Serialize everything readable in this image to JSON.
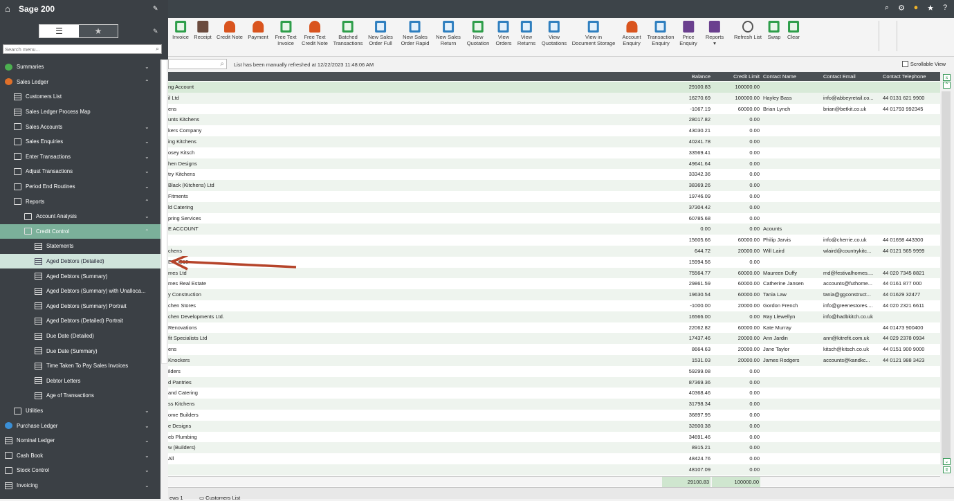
{
  "app": {
    "title": "Sage 200"
  },
  "sidebar": {
    "search_placeholder": "Search menu...",
    "items": [
      {
        "label": "Summaries",
        "chev": "⌄"
      },
      {
        "label": "Sales Ledger",
        "chev": "⌃"
      },
      {
        "label": "Customers List",
        "chev": ""
      },
      {
        "label": "Sales Ledger Process Map",
        "chev": ""
      },
      {
        "label": "Sales Accounts",
        "chev": "⌄"
      },
      {
        "label": "Sales Enquiries",
        "chev": "⌄"
      },
      {
        "label": "Enter Transactions",
        "chev": "⌄"
      },
      {
        "label": "Adjust Transactions",
        "chev": "⌄"
      },
      {
        "label": "Period End Routines",
        "chev": "⌄"
      },
      {
        "label": "Reports",
        "chev": "⌃"
      },
      {
        "label": "Account Analysis",
        "chev": "⌄"
      },
      {
        "label": "Credit Control",
        "chev": "⌃"
      },
      {
        "label": "Statements",
        "chev": ""
      },
      {
        "label": "Aged Debtors (Detailed)",
        "chev": ""
      },
      {
        "label": "Aged Debtors (Summary)",
        "chev": ""
      },
      {
        "label": "Aged Debtors (Summary) with Unalloca...",
        "chev": ""
      },
      {
        "label": "Aged Debtors (Summary) Portrait",
        "chev": ""
      },
      {
        "label": "Aged Debtors (Detailed) Portrait",
        "chev": ""
      },
      {
        "label": "Due Date (Detailed)",
        "chev": ""
      },
      {
        "label": "Due Date (Summary)",
        "chev": ""
      },
      {
        "label": "Time Taken To Pay Sales Invoices",
        "chev": ""
      },
      {
        "label": "Debtor Letters",
        "chev": ""
      },
      {
        "label": "Age of Transactions",
        "chev": ""
      },
      {
        "label": "Utilities",
        "chev": "⌄"
      },
      {
        "label": "Purchase Ledger",
        "chev": "⌄"
      },
      {
        "label": "Nominal Ledger",
        "chev": "⌄"
      },
      {
        "label": "Cash Book",
        "chev": "⌄"
      },
      {
        "label": "Stock Control",
        "chev": "⌄"
      },
      {
        "label": "Invoicing",
        "chev": "⌄"
      }
    ]
  },
  "ribbon": {
    "buttons": [
      {
        "l1": "Invoice",
        "l2": ""
      },
      {
        "l1": "Receipt",
        "l2": ""
      },
      {
        "l1": "Credit Note",
        "l2": ""
      },
      {
        "l1": "Payment",
        "l2": ""
      },
      {
        "l1": "Free Text",
        "l2": "Invoice"
      },
      {
        "l1": "Free Text",
        "l2": "Credit Note"
      },
      {
        "l1": "Batched",
        "l2": "Transactions"
      },
      {
        "l1": "New Sales",
        "l2": "Order Full"
      },
      {
        "l1": "New Sales",
        "l2": "Order Rapid"
      },
      {
        "l1": "New Sales",
        "l2": "Return"
      },
      {
        "l1": "New",
        "l2": "Quotation"
      },
      {
        "l1": "View",
        "l2": "Orders"
      },
      {
        "l1": "View",
        "l2": "Returns"
      },
      {
        "l1": "View",
        "l2": "Quotations"
      },
      {
        "l1": "View in",
        "l2": "Document Storage"
      },
      {
        "l1": "Account",
        "l2": "Enquiry"
      },
      {
        "l1": "Transaction",
        "l2": "Enquiry"
      },
      {
        "l1": "Price",
        "l2": "Enquiry"
      },
      {
        "l1": "Reports",
        "l2": "▾"
      },
      {
        "l1": "Refresh List",
        "l2": ""
      },
      {
        "l1": "Swap",
        "l2": ""
      },
      {
        "l1": "Clear",
        "l2": ""
      }
    ]
  },
  "filter": {
    "refresh_message": "List has been manually refreshed at 12/22/2023 11:48:06 AM",
    "scrollable_label": "Scrollable View"
  },
  "grid": {
    "headers": {
      "balance": "Balance",
      "credit_limit": "Credit Limit",
      "contact_name": "Contact Name",
      "contact_email": "Contact Email",
      "contact_telephone": "Contact Telephone"
    },
    "rows": [
      {
        "name": "ng Account",
        "balance": "29100.83",
        "limit": "100000.00",
        "contact": "",
        "email": "",
        "tel": ""
      },
      {
        "name": "il Ltd",
        "balance": "16270.69",
        "limit": "100000.00",
        "contact": "Hayley Bass",
        "email": "info@abbeyretail.co...",
        "tel": "44 0131 621 9900"
      },
      {
        "name": "ens",
        "balance": "-1067.19",
        "limit": "60000.00",
        "contact": "Brian Lynch",
        "email": "brian@betkit.co.uk",
        "tel": "44 01793 992345"
      },
      {
        "name": "unts Kitchens",
        "balance": "28017.82",
        "limit": "0.00",
        "contact": "",
        "email": "",
        "tel": ""
      },
      {
        "name": "kers Company",
        "balance": "43030.21",
        "limit": "0.00",
        "contact": "",
        "email": "",
        "tel": ""
      },
      {
        "name": "ing Kitchens",
        "balance": "40241.78",
        "limit": "0.00",
        "contact": "",
        "email": "",
        "tel": ""
      },
      {
        "name": "osey Kitsch",
        "balance": "33569.41",
        "limit": "0.00",
        "contact": "",
        "email": "",
        "tel": ""
      },
      {
        "name": "hen Designs",
        "balance": "49641.64",
        "limit": "0.00",
        "contact": "",
        "email": "",
        "tel": ""
      },
      {
        "name": "try Kitchens",
        "balance": "33342.36",
        "limit": "0.00",
        "contact": "",
        "email": "",
        "tel": ""
      },
      {
        "name": "Black (Kitchens) Ltd",
        "balance": "38369.26",
        "limit": "0.00",
        "contact": "",
        "email": "",
        "tel": ""
      },
      {
        "name": "Fitments",
        "balance": "19746.09",
        "limit": "0.00",
        "contact": "",
        "email": "",
        "tel": ""
      },
      {
        "name": "ld Catering",
        "balance": "37304.42",
        "limit": "0.00",
        "contact": "",
        "email": "",
        "tel": ""
      },
      {
        "name": "pring Services",
        "balance": "60785.68",
        "limit": "0.00",
        "contact": "",
        "email": "",
        "tel": ""
      },
      {
        "name": "E ACCOUNT",
        "balance": "0.00",
        "limit": "0.00",
        "contact": "Acounts",
        "email": "",
        "tel": ""
      },
      {
        "name": "",
        "balance": "15605.66",
        "limit": "60000.00",
        "contact": "Philip Jarvis",
        "email": "info@cherrie.co.uk",
        "tel": "44 01698 443300"
      },
      {
        "name": "chens",
        "balance": "644.72",
        "limit": "20000.00",
        "contact": "Will Laird",
        "email": "wlaird@countrykitc...",
        "tel": "44 0121 565 9999"
      },
      {
        "name": "EPOS10",
        "balance": "15994.56",
        "limit": "0.00",
        "contact": "",
        "email": "",
        "tel": ""
      },
      {
        "name": "mes Ltd",
        "balance": "75564.77",
        "limit": "60000.00",
        "contact": "Maureen Duffy",
        "email": "md@festivalhomes....",
        "tel": "44 020 7345 8821"
      },
      {
        "name": "mes Real Estate",
        "balance": "29861.59",
        "limit": "60000.00",
        "contact": "Catherine Jansen",
        "email": "accounts@futhome...",
        "tel": "44 0161 877 000"
      },
      {
        "name": "y Construction",
        "balance": "19630.54",
        "limit": "60000.00",
        "contact": "Tania Law",
        "email": "tania@ggconstruct...",
        "tel": "44 01629 32477"
      },
      {
        "name": "chen Stores",
        "balance": "-1000.00",
        "limit": "20000.00",
        "contact": "Gordon French",
        "email": "info@greenestores....",
        "tel": "44 020 2321 6611"
      },
      {
        "name": "chen Developments Ltd.",
        "balance": "16566.00",
        "limit": "0.00",
        "contact": "Ray Llewellyn",
        "email": "info@hadbkitch.co.uk",
        "tel": ""
      },
      {
        "name": "Renovations",
        "balance": "22062.82",
        "limit": "60000.00",
        "contact": "Kate Murray",
        "email": "",
        "tel": "44 01473 900400"
      },
      {
        "name": "fit Specialists Ltd",
        "balance": "17437.46",
        "limit": "20000.00",
        "contact": "Ann Jardin",
        "email": "ann@kitrefit.com.uk",
        "tel": "44 029 2378 0934"
      },
      {
        "name": "ens",
        "balance": "8664.63",
        "limit": "20000.00",
        "contact": "Jane Taylor",
        "email": "kitsch@kitsch.co.uk",
        "tel": "44 0151 900 9000"
      },
      {
        "name": "Knockers",
        "balance": "1531.03",
        "limit": "20000.00",
        "contact": "James Rodgers",
        "email": "accounts@kandkc...",
        "tel": "44 0121 988 3423"
      },
      {
        "name": "ilders",
        "balance": "59299.08",
        "limit": "0.00",
        "contact": "",
        "email": "",
        "tel": ""
      },
      {
        "name": "d Pantries",
        "balance": "87369.36",
        "limit": "0.00",
        "contact": "",
        "email": "",
        "tel": ""
      },
      {
        "name": "and Catering",
        "balance": "40368.46",
        "limit": "0.00",
        "contact": "",
        "email": "",
        "tel": ""
      },
      {
        "name": "ss Kitchens",
        "balance": "31798.34",
        "limit": "0.00",
        "contact": "",
        "email": "",
        "tel": ""
      },
      {
        "name": "ome Builders",
        "balance": "36897.95",
        "limit": "0.00",
        "contact": "",
        "email": "",
        "tel": ""
      },
      {
        "name": "e Designs",
        "balance": "32600.38",
        "limit": "0.00",
        "contact": "",
        "email": "",
        "tel": ""
      },
      {
        "name": "eb Plumbing",
        "balance": "34691.46",
        "limit": "0.00",
        "contact": "",
        "email": "",
        "tel": ""
      },
      {
        "name": "w (Builders)",
        "balance": "8915.21",
        "limit": "0.00",
        "contact": "",
        "email": "",
        "tel": ""
      },
      {
        "name": "All",
        "balance": "48424.76",
        "limit": "0.00",
        "contact": "",
        "email": "",
        "tel": ""
      },
      {
        "name": "",
        "balance": "48107.09",
        "limit": "0.00",
        "contact": "",
        "email": "",
        "tel": ""
      }
    ],
    "totals": {
      "balance": "29100.83",
      "limit": "100000.00"
    }
  },
  "bottom": {
    "tab1": "ews 1",
    "tab2": "Customers List"
  },
  "colors": {
    "sidebar_bg": "#3b4045",
    "active_item": "#7bb09a",
    "selected_item": "#cfe4db",
    "arrow": "#b5442a"
  }
}
